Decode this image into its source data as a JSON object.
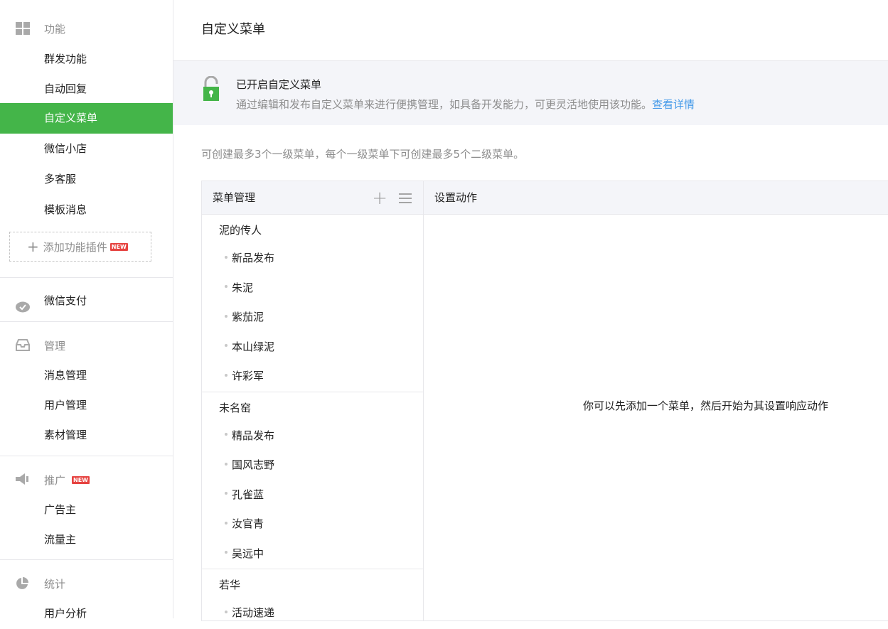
{
  "sidebar": {
    "sections": [
      {
        "title": "功能",
        "icon": "grid-icon",
        "items": [
          {
            "label": "群发功能"
          },
          {
            "label": "自动回复"
          },
          {
            "label": "自定义菜单",
            "active": true
          },
          {
            "label": "微信小店"
          },
          {
            "label": "多客服"
          },
          {
            "label": "模板消息"
          }
        ]
      },
      {
        "title": "微信支付",
        "icon": "chat-bubble-icon",
        "items": []
      },
      {
        "title": "管理",
        "icon": "inbox-icon",
        "items": [
          {
            "label": "消息管理"
          },
          {
            "label": "用户管理"
          },
          {
            "label": "素材管理"
          }
        ]
      },
      {
        "title": "推广",
        "icon": "megaphone-icon",
        "badge": "NEW",
        "items": [
          {
            "label": "广告主"
          },
          {
            "label": "流量主"
          }
        ]
      },
      {
        "title": "统计",
        "icon": "pie-chart-icon",
        "items": [
          {
            "label": "用户分析"
          }
        ]
      }
    ],
    "add_plugin": {
      "label": "添加功能插件",
      "badge": "NEW"
    }
  },
  "main": {
    "title": "自定义菜单",
    "notice": {
      "title": "已开启自定义菜单",
      "desc": "通过编辑和发布自定义菜单来进行便携管理，如具备开发能力，可更灵活地使用该功能。",
      "link": "查看详情"
    },
    "hint": "可创建最多3个一级菜单，每个一级菜单下可创建最多5个二级菜单。",
    "menu_panel": {
      "left_header": "菜单管理",
      "right_header": "设置动作",
      "empty_tip": "你可以先添加一个菜单，然后开始为其设置响应动作",
      "groups": [
        {
          "name": "泥的传人",
          "items": [
            "新品发布",
            "朱泥",
            "紫茄泥",
            "本山绿泥",
            "许彩军"
          ]
        },
        {
          "name": "未名窑",
          "items": [
            "精品发布",
            "国风志野",
            "孔雀蓝",
            "汝官青",
            "吴远中"
          ]
        },
        {
          "name": "若华",
          "items": [
            "活动速递"
          ]
        }
      ]
    }
  },
  "colors": {
    "accent": "#44b549",
    "link": "#459ae9",
    "new_badge": "#e64340"
  }
}
